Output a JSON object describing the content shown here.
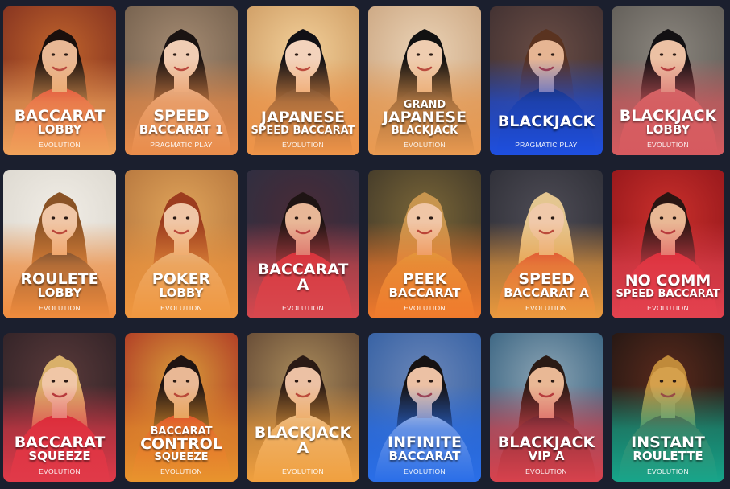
{
  "games": [
    {
      "lines": [
        "BACCARAT",
        "LOBBY"
      ],
      "provider": "EVOLUTION",
      "bg": "#7a2a1e",
      "bg2": "#c0642c",
      "band": "#f0a25a",
      "dress": "#d81f2a",
      "hair": "#1a0f0c",
      "skin": "#e9b895"
    },
    {
      "lines": [
        "SPEED",
        "BACCARAT 1"
      ],
      "provider": "PRAGMATIC PLAY",
      "bg": "#6d5a48",
      "bg2": "#a58b72",
      "band": "#e98c4a",
      "dress": "#e5c7b2",
      "hair": "#1a1312",
      "skin": "#f0cdb4"
    },
    {
      "lines": [
        "JAPANESE",
        "SPEED BACCARAT"
      ],
      "provider": "EVOLUTION",
      "bg": "#c9955c",
      "bg2": "#f2cf99",
      "band": "#ef9448",
      "dress": "#1b1b22",
      "hair": "#111015",
      "skin": "#f3d3bc"
    },
    {
      "lines": [
        "GRAND",
        "JAPANESE",
        "BLACKJACK"
      ],
      "provider": "EVOLUTION",
      "bg": "#c7a07a",
      "bg2": "#ead2b5",
      "band": "#ea9a50",
      "dress": "#151518",
      "hair": "#111111",
      "skin": "#efcdb0"
    },
    {
      "lines": [
        "BLACKJACK"
      ],
      "provider": "PRAGMATIC PLAY",
      "bg": "#3a2c2e",
      "bg2": "#6a4d45",
      "band": "#1e4fe0",
      "dress": "#1a2036",
      "hair": "#5a3320",
      "skin": "#e6b593"
    },
    {
      "lines": [
        "BLACKJACK",
        "LOBBY"
      ],
      "provider": "EVOLUTION",
      "bg": "#5b5752",
      "bg2": "#8a857d",
      "band": "#d65a5f",
      "dress": "#d36b6b",
      "hair": "#121012",
      "skin": "#ecc1a4"
    },
    {
      "lines": [
        "ROULETE",
        "LOBBY"
      ],
      "provider": "EVOLUTION",
      "bg": "#d9d5cc",
      "bg2": "#f1ede6",
      "band": "#f08c3d",
      "dress": "#222228",
      "hair": "#8a5326",
      "skin": "#f0c6a6"
    },
    {
      "lines": [
        "POKER",
        "LOBBY"
      ],
      "provider": "EVOLUTION",
      "bg": "#b0703a",
      "bg2": "#e0a45a",
      "band": "#f0973f",
      "dress": "#e2c6a9",
      "hair": "#9c3c1e",
      "skin": "#f0c6a6"
    },
    {
      "lines": [
        "BACCARAT A"
      ],
      "provider": "EVOLUTION",
      "bg": "#2a3043",
      "bg2": "#4a2a36",
      "band": "#d8484e",
      "dress": "#d81f2a",
      "hair": "#1e1413",
      "skin": "#e8b797"
    },
    {
      "lines": [
        "PEEK",
        "BACCARAT"
      ],
      "provider": "EVOLUTION",
      "bg": "#3a3327",
      "bg2": "#7a6638",
      "band": "#f07a2c",
      "dress": "#d6b04a",
      "hair": "#c8954e",
      "skin": "#f0c6a6"
    },
    {
      "lines": [
        "SPEED",
        "BACCARAT A"
      ],
      "provider": "EVOLUTION",
      "bg": "#2a2b33",
      "bg2": "#4e4c55",
      "band": "#eb9a3e",
      "dress": "#d8242c",
      "hair": "#e4c690",
      "skin": "#f0c9aa"
    },
    {
      "lines": [
        "NO COMM",
        "SPEED BACCARAT"
      ],
      "provider": "EVOLUTION",
      "bg": "#8d1318",
      "bg2": "#c9302c",
      "band": "#e2424f",
      "dress": "#d81f2a",
      "hair": "#2a1512",
      "skin": "#e9b895"
    },
    {
      "lines": [
        "BACCARAT",
        "SQUEEZE"
      ],
      "provider": "EVOLUTION",
      "bg": "#2b1f24",
      "bg2": "#5a3a3a",
      "band": "#e03a49",
      "dress": "#d81f2a",
      "hair": "#d9b06a",
      "skin": "#f0c6a6"
    },
    {
      "lines": [
        "BACCARAT",
        "CONTROL",
        "SQUEEZE"
      ],
      "provider": "EVOLUTION",
      "bg": "#a82a22",
      "bg2": "#d99c3a",
      "band": "#e8942d",
      "dress": "#d81f2a",
      "hair": "#1f1412",
      "skin": "#e9b895"
    },
    {
      "lines": [
        "BLACKJACK A"
      ],
      "provider": "EVOLUTION",
      "bg": "#5a4030",
      "bg2": "#a98a5a",
      "band": "#f0a03f",
      "dress": "#ead6c2",
      "hair": "#2a1a14",
      "skin": "#ecc1a4"
    },
    {
      "lines": [
        "INFINITE",
        "BACCARAT"
      ],
      "provider": "EVOLUTION",
      "bg": "#2c5aa0",
      "bg2": "#6a86b8",
      "band": "#2a6ee8",
      "dress": "#f1e6dc",
      "hair": "#161212",
      "skin": "#ecc1a4"
    },
    {
      "lines": [
        "BLACKJACK",
        "VIP A"
      ],
      "provider": "EVOLUTION",
      "bg": "#2d5a7a",
      "bg2": "#8aa3b3",
      "band": "#d8424d",
      "dress": "#111219",
      "hair": "#2a1a14",
      "skin": "#e9b895"
    },
    {
      "lines": [
        "INSTANT",
        "ROULETTE"
      ],
      "provider": "EVOLUTION",
      "bg": "#1b1412",
      "bg2": "#5a2a1c",
      "band": "#17a58a",
      "dress": "#8a3a1c",
      "hair": "#c08a3a",
      "skin": "#d5a04c"
    }
  ]
}
